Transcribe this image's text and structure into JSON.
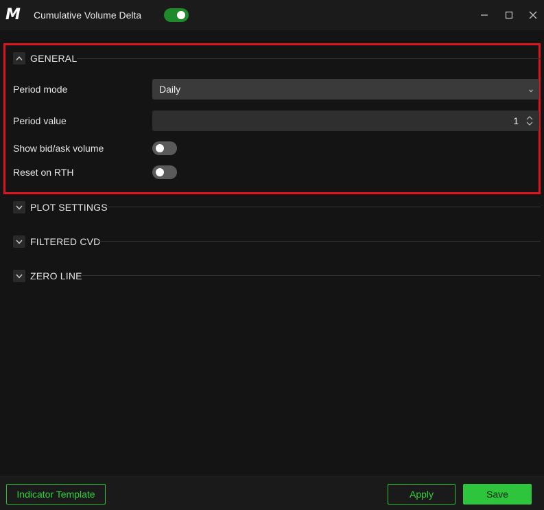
{
  "window": {
    "logo_text": "M",
    "title": "Cumulative Volume Delta",
    "enabled": true
  },
  "sections": {
    "general": "GENERAL",
    "plot_settings": "PLOT SETTINGS",
    "filtered_cvd": "FILTERED CVD",
    "zero_line": "ZERO LINE"
  },
  "general": {
    "period_mode_label": "Period mode",
    "period_mode_value": "Daily",
    "period_value_label": "Period value",
    "period_value": "1",
    "show_bid_ask_label": "Show bid/ask volume",
    "show_bid_ask_on": false,
    "reset_rth_label": "Reset on RTH",
    "reset_rth_on": false
  },
  "footer": {
    "template_label": "Indicator Template",
    "apply_label": "Apply",
    "save_label": "Save"
  },
  "colors": {
    "accent": "#2ec43b",
    "highlight": "#e0141e",
    "background": "#141414"
  }
}
